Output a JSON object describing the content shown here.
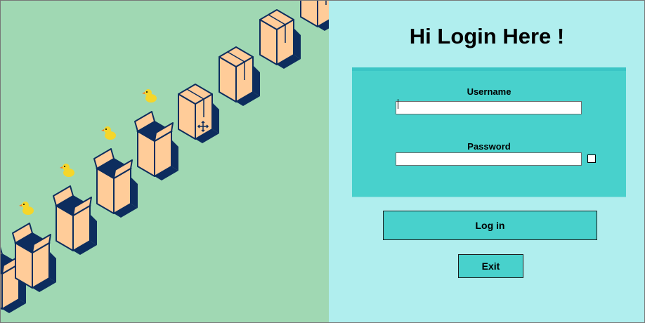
{
  "login": {
    "title": "Hi Login Here !",
    "username_label": "Username",
    "username_value": "",
    "password_label": "Password",
    "password_value": "",
    "login_label": "Log in",
    "exit_label": "Exit"
  },
  "illustration": {
    "description_icons": [
      "box-icon",
      "duck-icon"
    ],
    "colors": {
      "background_left": "#a0d8b3",
      "background_right": "#b0eeee",
      "box_fill": "#ffcc99",
      "box_stroke": "#0d2d5e",
      "duck": "#f5d62a",
      "panel": "#48d1cc"
    }
  }
}
